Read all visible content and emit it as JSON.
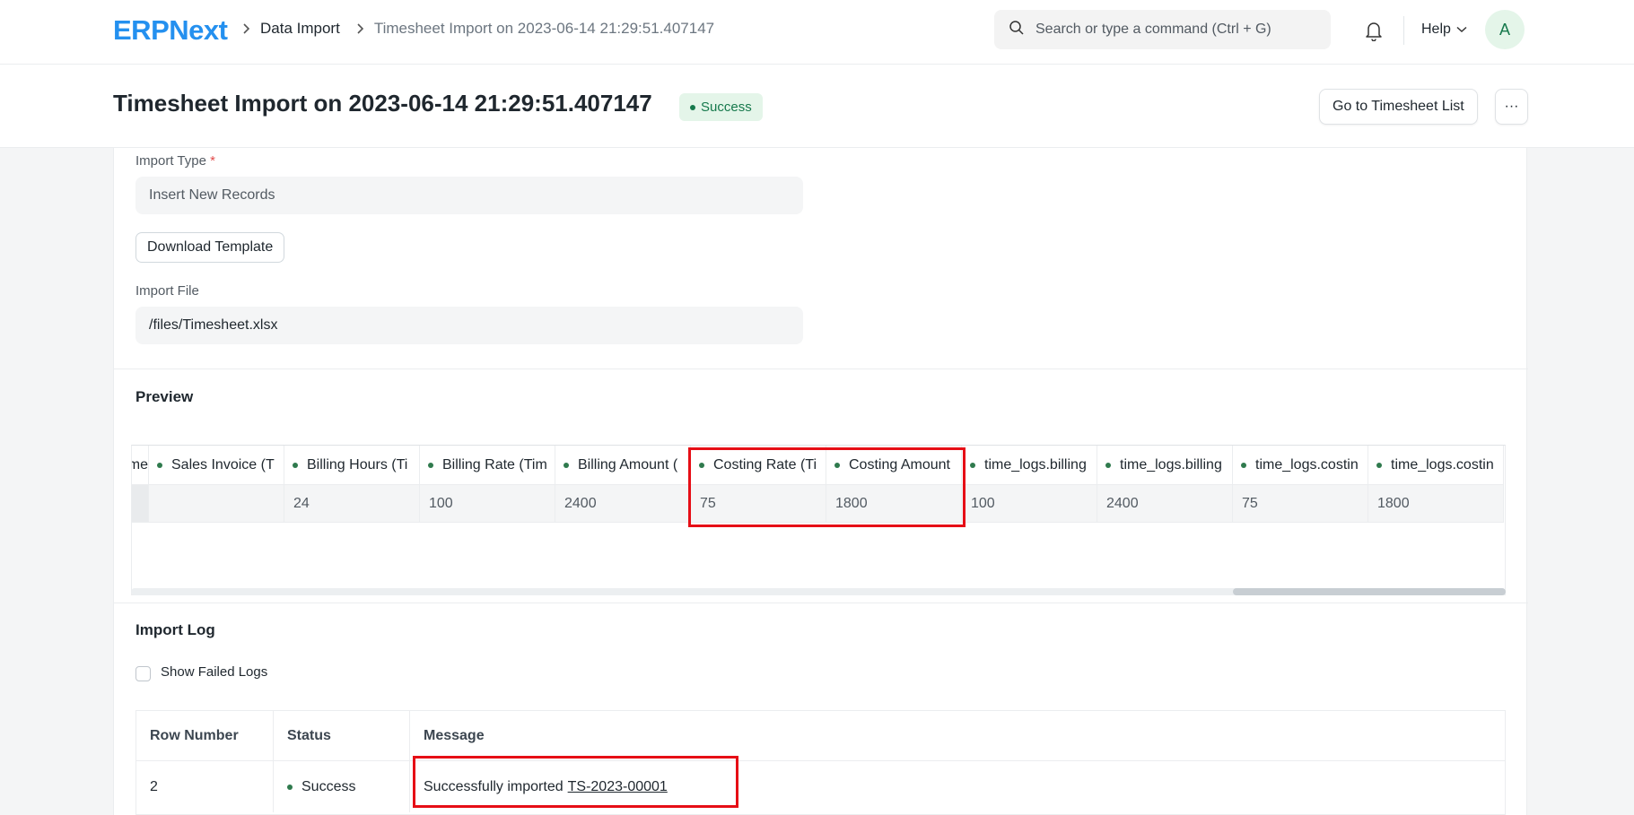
{
  "app": {
    "logo": "ERPNext"
  },
  "breadcrumb": {
    "parent": "Data Import",
    "current": "Timesheet Import on 2023-06-14 21:29:51.407147"
  },
  "search": {
    "placeholder": "Search or type a command (Ctrl + G)"
  },
  "navbar": {
    "help_label": "Help",
    "avatar_initial": "A"
  },
  "page": {
    "title": "Timesheet Import on 2023-06-14 21:29:51.407147",
    "status": "Success",
    "primary_button": "Go to Timesheet List",
    "more_button": "···"
  },
  "form": {
    "import_type_label": "Import Type",
    "required_mark": "*",
    "import_type_value": "Insert New Records",
    "download_template_label": "Download Template",
    "import_file_label": "Import File",
    "import_file_value": "/files/Timesheet.xlsx"
  },
  "preview": {
    "title": "Preview",
    "columns": [
      {
        "label": "me",
        "dot": false
      },
      {
        "label": "Sales Invoice (T",
        "dot": true
      },
      {
        "label": "Billing Hours (Ti",
        "dot": true
      },
      {
        "label": "Billing Rate (Tim",
        "dot": true
      },
      {
        "label": "Billing Amount (",
        "dot": true
      },
      {
        "label": "Costing Rate (Ti",
        "dot": true
      },
      {
        "label": "Costing Amount",
        "dot": true
      },
      {
        "label": "time_logs.billing",
        "dot": true
      },
      {
        "label": "time_logs.billing",
        "dot": true
      },
      {
        "label": "time_logs.costin",
        "dot": true
      },
      {
        "label": "time_logs.costin",
        "dot": true
      }
    ],
    "row": [
      "",
      "",
      "24",
      "100",
      "2400",
      "75",
      "1800",
      "100",
      "2400",
      "75",
      "1800"
    ]
  },
  "import_log": {
    "title": "Import Log",
    "show_failed_label": "Show Failed Logs",
    "headers": [
      "Row Number",
      "Status",
      "Message"
    ],
    "rows": [
      {
        "row_number": "2",
        "status": "Success",
        "message_prefix": "Successfully imported",
        "doc_link": "TS-2023-00001"
      }
    ]
  }
}
